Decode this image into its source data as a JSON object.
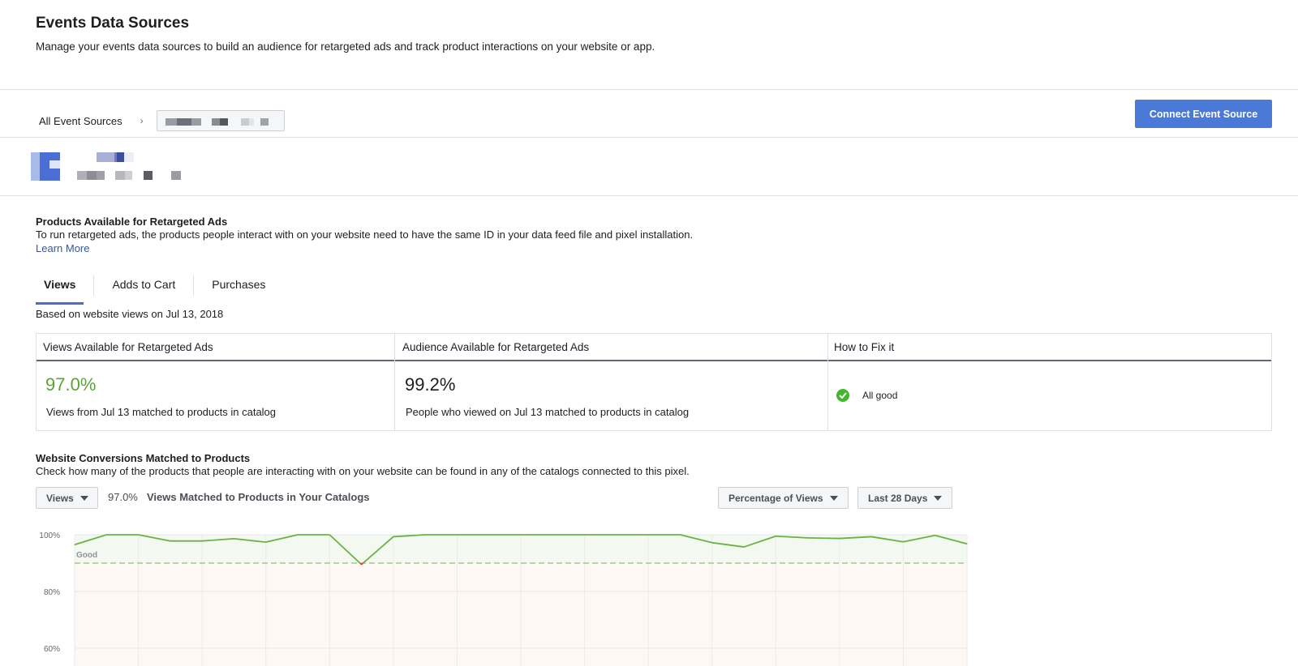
{
  "header": {
    "title": "Events Data Sources",
    "subtitle": "Manage your events data sources to build an audience for retargeted ads and track product interactions on your website or app."
  },
  "breadcrumb": {
    "root": "All Event Sources",
    "separator": "›"
  },
  "connect_button": "Connect Event Source",
  "products_section": {
    "title": "Products Available for Retargeted Ads",
    "description": "To run retargeted ads, the products people interact with on your website need to have the same ID in your data feed file and pixel installation.",
    "learn_more": "Learn More"
  },
  "tabs": [
    {
      "label": "Views",
      "active": true
    },
    {
      "label": "Adds to Cart",
      "active": false
    },
    {
      "label": "Purchases",
      "active": false
    }
  ],
  "based_on": "Based on website views on Jul 13, 2018",
  "table": {
    "headers": [
      "Views Available for Retargeted Ads",
      "Audience Available for Retargeted Ads",
      "How to Fix it"
    ],
    "views_pct": "97.0%",
    "views_desc": "Views from Jul 13 matched to products in catalog",
    "audience_pct": "99.2%",
    "audience_desc": "People who viewed on Jul 13 matched to products in catalog",
    "fix_status": "All good"
  },
  "conversions_section": {
    "title": "Website Conversions Matched to Products",
    "description": "Check how many of the products that people are interacting with on your website can be found in any of the catalogs connected to this pixel."
  },
  "controls": {
    "event_dropdown": "Views",
    "metric_value": "97.0%",
    "metric_label": "Views Matched to Products in Your Catalogs",
    "measure_dropdown": "Percentage of Views",
    "range_dropdown": "Last 28 Days"
  },
  "colors": {
    "accent": "#4a79d8",
    "good": "#5aa532",
    "line": "#6bb144",
    "dip": "#e0463a"
  },
  "chart_data": {
    "type": "line",
    "ytick_labels": [
      "100%",
      "80%",
      "60%"
    ],
    "good_label": "Good",
    "good_threshold": 90,
    "ylim": [
      55,
      100
    ],
    "values": [
      96.5,
      100,
      100,
      97.8,
      97.8,
      98.6,
      97.4,
      100,
      100,
      89.5,
      99.3,
      100,
      100,
      100,
      100,
      100,
      100,
      100,
      100,
      100,
      97.2,
      95.7,
      99.5,
      98.9,
      98.7,
      99.3,
      97.5,
      99.8,
      96.8
    ]
  }
}
